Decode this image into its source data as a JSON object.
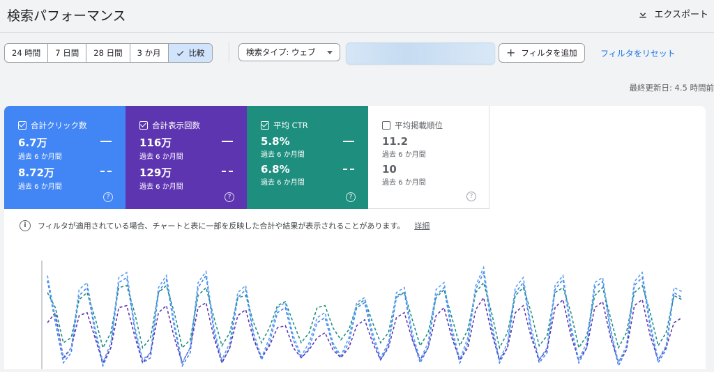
{
  "header": {
    "title": "検索パフォーマンス",
    "export_label": "エクスポート"
  },
  "date_ranges": [
    "24 時間",
    "7 日間",
    "28 日間",
    "3 か月",
    "比較"
  ],
  "active_range": "比較",
  "search_type": "検索タイプ: ウェブ",
  "add_filter_label": "フィルタを追加",
  "reset_filter_label": "フィルタをリセット",
  "last_updated": "最終更新日: 4.5 時間前",
  "metrics": [
    {
      "label": "合計クリック数",
      "checked": true,
      "value1": "6.7万",
      "period1": "過去 6 か月間",
      "value2": "8.72万",
      "period2": "過去 6 か月間",
      "color": "#4285f4"
    },
    {
      "label": "合計表示回数",
      "checked": true,
      "value1": "116万",
      "period1": "過去 6 か月間",
      "value2": "129万",
      "period2": "過去 6 か月間",
      "color": "#5e35b1"
    },
    {
      "label": "平均 CTR",
      "checked": true,
      "value1": "5.8%",
      "period1": "過去 6 か月間",
      "value2": "6.8%",
      "period2": "過去 6 か月間",
      "color": "#1e8e7e"
    },
    {
      "label": "平均掲載順位",
      "checked": false,
      "value1": "11.2",
      "period1": "過去 6 か月間",
      "value2": "10",
      "period2": "過去 6 か月間",
      "color": "#ffffff"
    }
  ],
  "notice": {
    "text": "フィルタが適用されている場合、チャートと表に一部を反映した合計や結果が表示されることがあります。",
    "link": "詳細"
  },
  "chart_data": {
    "type": "line",
    "series": [
      {
        "color": "#4285f4",
        "values": [
          0.87,
          0.45,
          0.05,
          0.15,
          0.72,
          0.8,
          0.35,
          0.02,
          0.2,
          0.85,
          0.9,
          0.38,
          0.05,
          0.1,
          0.75,
          0.88,
          0.4,
          0.02,
          0.15,
          0.8,
          0.92,
          0.35,
          0.05,
          0.2,
          0.7,
          0.78,
          0.3,
          0.08,
          0.25,
          0.55,
          0.6,
          0.28,
          0.1,
          0.2,
          0.45,
          0.5,
          0.22,
          0.1,
          0.25,
          0.6,
          0.65,
          0.3,
          0.08,
          0.22,
          0.7,
          0.75,
          0.3,
          0.05,
          0.2,
          0.72,
          0.8,
          0.35,
          0.05,
          0.25,
          0.78,
          0.95,
          0.4,
          0.05,
          0.2,
          0.75,
          0.85,
          0.35,
          0.05,
          0.15,
          0.78,
          0.88,
          0.38,
          0.05,
          0.2,
          0.8,
          0.86,
          0.35,
          0.02,
          0.18,
          0.82,
          0.9,
          0.4,
          0.05,
          0.18,
          0.75,
          0.7
        ]
      },
      {
        "color": "#1e8e7e",
        "values": [
          0.75,
          0.6,
          0.25,
          0.3,
          0.68,
          0.75,
          0.5,
          0.2,
          0.35,
          0.8,
          0.82,
          0.55,
          0.2,
          0.3,
          0.75,
          0.82,
          0.55,
          0.2,
          0.28,
          0.72,
          0.8,
          0.5,
          0.22,
          0.35,
          0.7,
          0.72,
          0.45,
          0.25,
          0.4,
          0.62,
          0.66,
          0.45,
          0.25,
          0.35,
          0.6,
          0.62,
          0.4,
          0.28,
          0.38,
          0.62,
          0.68,
          0.45,
          0.25,
          0.35,
          0.72,
          0.75,
          0.48,
          0.22,
          0.35,
          0.7,
          0.78,
          0.5,
          0.22,
          0.38,
          0.75,
          0.85,
          0.55,
          0.2,
          0.35,
          0.72,
          0.8,
          0.55,
          0.22,
          0.32,
          0.75,
          0.8,
          0.55,
          0.2,
          0.32,
          0.72,
          0.8,
          0.5,
          0.2,
          0.35,
          0.75,
          0.82,
          0.55,
          0.22,
          0.35,
          0.72,
          0.68
        ]
      },
      {
        "color": "#5e35b1",
        "values": [
          0.45,
          0.55,
          0.1,
          0.2,
          0.52,
          0.55,
          0.3,
          0.05,
          0.2,
          0.6,
          0.62,
          0.32,
          0.05,
          0.15,
          0.55,
          0.62,
          0.3,
          0.05,
          0.2,
          0.6,
          0.65,
          0.3,
          0.05,
          0.2,
          0.52,
          0.58,
          0.28,
          0.1,
          0.22,
          0.4,
          0.42,
          0.2,
          0.1,
          0.18,
          0.3,
          0.35,
          0.18,
          0.1,
          0.2,
          0.42,
          0.48,
          0.25,
          0.08,
          0.2,
          0.5,
          0.55,
          0.28,
          0.08,
          0.2,
          0.52,
          0.6,
          0.3,
          0.08,
          0.2,
          0.58,
          0.7,
          0.35,
          0.08,
          0.2,
          0.55,
          0.62,
          0.3,
          0.08,
          0.18,
          0.6,
          0.68,
          0.32,
          0.08,
          0.2,
          0.6,
          0.66,
          0.3,
          0.06,
          0.18,
          0.62,
          0.68,
          0.32,
          0.08,
          0.2,
          0.45,
          0.5
        ]
      },
      {
        "color": "#5b9ff0",
        "values": [
          0.92,
          0.5,
          0.08,
          0.2,
          0.78,
          0.85,
          0.4,
          0.05,
          0.25,
          0.9,
          0.95,
          0.42,
          0.08,
          0.15,
          0.8,
          0.92,
          0.45,
          0.05,
          0.2,
          0.85,
          0.96,
          0.4,
          0.08,
          0.25,
          0.75,
          0.82,
          0.35,
          0.1,
          0.3,
          0.6,
          0.65,
          0.32,
          0.12,
          0.25,
          0.5,
          0.55,
          0.25,
          0.12,
          0.3,
          0.65,
          0.7,
          0.35,
          0.1,
          0.25,
          0.75,
          0.8,
          0.35,
          0.08,
          0.25,
          0.78,
          0.85,
          0.4,
          0.08,
          0.3,
          0.82,
          1.0,
          0.45,
          0.08,
          0.25,
          0.8,
          0.9,
          0.4,
          0.08,
          0.2,
          0.82,
          0.92,
          0.42,
          0.08,
          0.25,
          0.85,
          0.9,
          0.4,
          0.05,
          0.22,
          0.86,
          0.95,
          0.45,
          0.08,
          0.22,
          0.8,
          0.76
        ]
      }
    ]
  }
}
